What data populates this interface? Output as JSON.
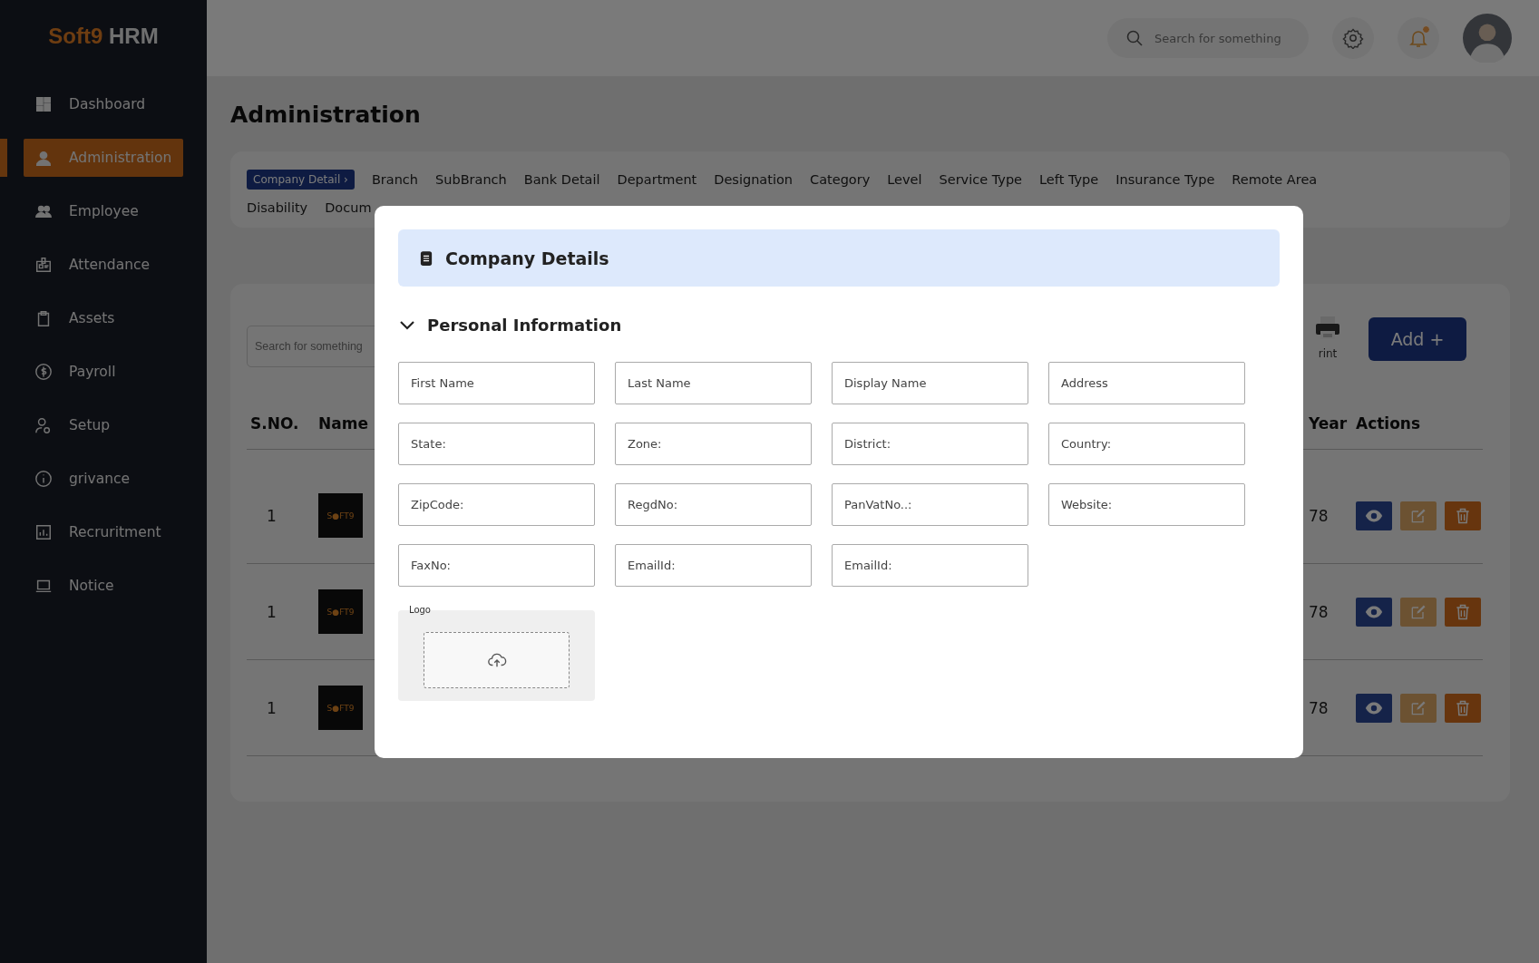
{
  "brand": {
    "name": "Soft9",
    "suffix": "HRM"
  },
  "sidebar": {
    "items": [
      {
        "label": "Dashboard",
        "selected": false
      },
      {
        "label": "Administration",
        "selected": true
      },
      {
        "label": "Employee",
        "selected": false
      },
      {
        "label": "Attendance",
        "selected": false
      },
      {
        "label": "Assets",
        "selected": false
      },
      {
        "label": "Payroll",
        "selected": false
      },
      {
        "label": "Setup",
        "selected": false
      },
      {
        "label": "grivance",
        "selected": false
      },
      {
        "label": "Recruritment",
        "selected": false
      },
      {
        "label": "Notice",
        "selected": false
      }
    ]
  },
  "topbar": {
    "search": {
      "placeholder": "Search for something"
    },
    "notifications": {
      "unread": true
    }
  },
  "page": {
    "title": "Administration"
  },
  "tabs": [
    {
      "label": "Company Detail ›",
      "selected": true
    },
    {
      "label": "Branch",
      "selected": false
    },
    {
      "label": "SubBranch",
      "selected": false
    },
    {
      "label": "Bank Detail",
      "selected": false
    },
    {
      "label": "Department",
      "selected": false
    },
    {
      "label": "Designation",
      "selected": false
    },
    {
      "label": "Category",
      "selected": false
    },
    {
      "label": "Level",
      "selected": false
    },
    {
      "label": "Service Type",
      "selected": false
    },
    {
      "label": "Left Type",
      "selected": false
    },
    {
      "label": "Insurance Type",
      "selected": false
    },
    {
      "label": "Remote Area",
      "selected": false
    },
    {
      "label": "Disability",
      "selected": false
    },
    {
      "label": "Docum",
      "selected": false
    }
  ],
  "table_card": {
    "search": {
      "placeholder": "Search for something"
    },
    "print_label": "rint",
    "add_button": "Add +",
    "columns": [
      "S.NO.",
      "Name",
      "Year",
      "Actions"
    ],
    "rows": [
      {
        "sno": "1",
        "logo_text": "S●FT9",
        "year": "78"
      },
      {
        "sno": "1",
        "logo_text": "S●FT9",
        "year": "78"
      },
      {
        "sno": "1",
        "logo_text": "S●FT9",
        "year": "78"
      }
    ]
  },
  "modal": {
    "title": "Company Details",
    "section": {
      "title": "Personal Information",
      "expanded": true
    },
    "fields": [
      {
        "placeholder": "First Name"
      },
      {
        "placeholder": "Last Name"
      },
      {
        "placeholder": "Display Name"
      },
      {
        "placeholder": "Address"
      },
      {
        "placeholder": "State:"
      },
      {
        "placeholder": "Zone:"
      },
      {
        "placeholder": "District:"
      },
      {
        "placeholder": "Country:"
      },
      {
        "placeholder": "ZipCode:"
      },
      {
        "placeholder": "RegdNo:"
      },
      {
        "placeholder": "PanVatNo..:"
      },
      {
        "placeholder": "Website:"
      },
      {
        "placeholder": "FaxNo:"
      },
      {
        "placeholder": "EmailId:"
      },
      {
        "placeholder": "EmailId:"
      }
    ],
    "logo_upload": {
      "label": "Logo"
    }
  }
}
